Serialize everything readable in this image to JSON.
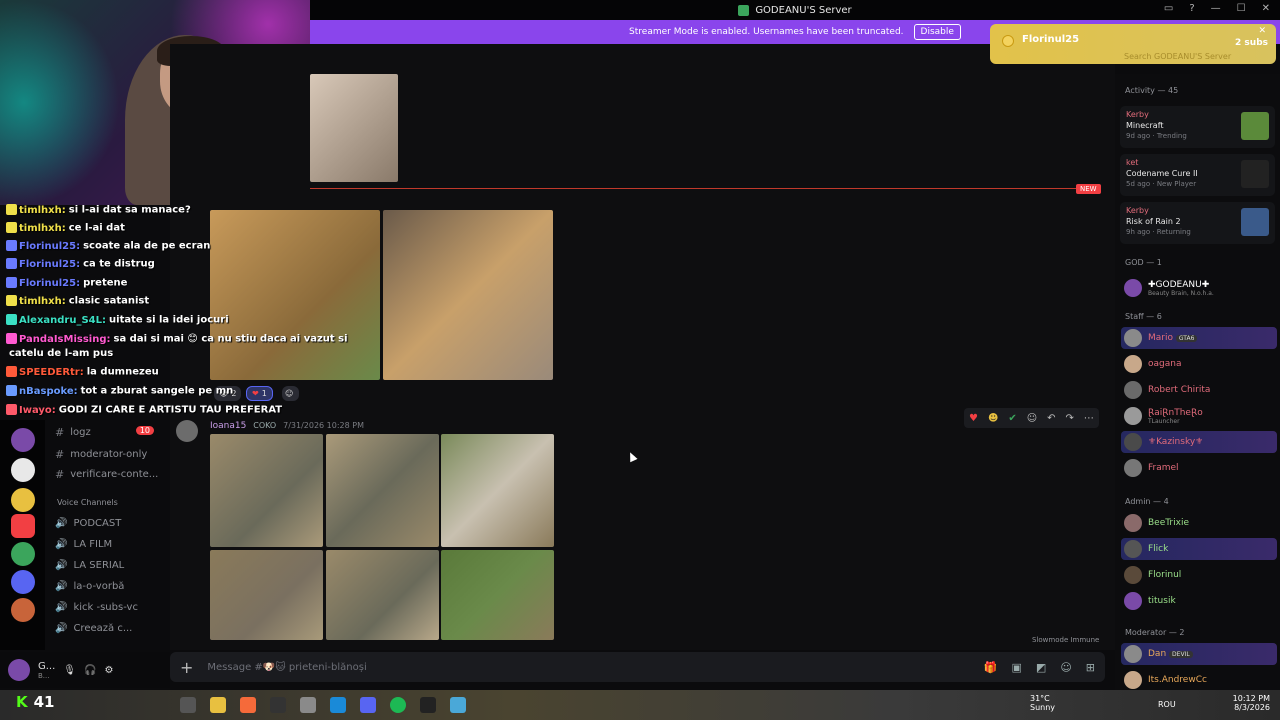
{
  "window": {
    "title": "GODEANU'S Server"
  },
  "banner": {
    "text": "Streamer Mode is enabled. Usernames have been truncated.",
    "disable_label": "Disable"
  },
  "alert": {
    "name": "Florinul25",
    "subs": "2 subs",
    "search_placeholder": "Search GODEANU'S Server"
  },
  "new_tag": "NEW",
  "channels": [
    {
      "label": "logz",
      "badge": "10"
    },
    {
      "label": "moderator-only"
    },
    {
      "label": "verificare-conte..."
    }
  ],
  "voice_header": "Voice Channels",
  "voice_channels": [
    "PODCAST",
    "LA FILM",
    "LA SERIAL",
    "la-o-vorbă",
    "kick -subs-vc",
    "Creează c..."
  ],
  "message": {
    "author": "Ioana15",
    "tag": "COKO",
    "time": "7/31/2026 10:28 PM",
    "reactions": [
      {
        "emoji": "😭",
        "count": "2"
      },
      {
        "emoji": "❤",
        "count": "1"
      }
    ]
  },
  "msgbar": {
    "placeholder": "Message #🐶🐱 prieteni-blănoși"
  },
  "slowmode": "Slowmode Immune",
  "userpanel": {
    "name": "G...",
    "sub": "B..."
  },
  "members": {
    "activity_header": "Activity — 45",
    "activities": [
      {
        "who": "Kerby",
        "game": "Minecraft",
        "meta": "9d ago · Trending",
        "color": "#5b8a3a"
      },
      {
        "who": "ket",
        "game": "Codename Cure II",
        "meta": "5d ago · New Player",
        "color": "#222"
      },
      {
        "who": "Kerby",
        "game": "Risk of Rain 2",
        "meta": "9h ago · Returning",
        "color": "#3a5a8a"
      }
    ],
    "groups": [
      {
        "header": "GOD — 1",
        "members": [
          {
            "name": "✚GODEANU✚",
            "sub": "Beauty Brain, N.o.h.a.",
            "color": "#fff"
          }
        ]
      },
      {
        "header": "Staff — 6",
        "members": [
          {
            "name": "Mario",
            "badge": "GTA6",
            "color": "#e06b7a",
            "hl": true
          },
          {
            "name": "oagana",
            "color": "#e06b7a"
          },
          {
            "name": "Robert Chirita",
            "color": "#e06b7a"
          },
          {
            "name": "ⱤaiⱤnTheⱤo",
            "sub": "TLauncher",
            "color": "#e06b7a"
          },
          {
            "name": "⚜Kazinsky⚜",
            "color": "#e06b7a",
            "hl": true
          },
          {
            "name": "Framel",
            "color": "#e06b7a"
          }
        ]
      },
      {
        "header": "Admin — 4",
        "members": [
          {
            "name": "BeeTrixie",
            "color": "#9be08a"
          },
          {
            "name": "Flick",
            "color": "#9be08a",
            "hl": true
          },
          {
            "name": "Florinul",
            "color": "#9be08a"
          },
          {
            "name": "titusik",
            "color": "#9be08a"
          }
        ]
      },
      {
        "header": "Moderator — 2",
        "members": [
          {
            "name": "Dan",
            "badge": "DEVIL",
            "color": "#e8a85a",
            "hl": true
          },
          {
            "name": "Its.AndrewCc",
            "color": "#e8a85a"
          }
        ]
      }
    ]
  },
  "twitch_chat": [
    {
      "name": "timlhxh:",
      "msg": "si l-ai dat sa manace?",
      "color": "#f0e04a"
    },
    {
      "name": "timlhxh:",
      "msg": "ce l-ai dat",
      "color": "#f0e04a"
    },
    {
      "name": "Florinul25:",
      "msg": "scoate ala de pe ecran",
      "color": "#6a7bff"
    },
    {
      "name": "Florinul25:",
      "msg": "ca te distrug",
      "color": "#6a7bff"
    },
    {
      "name": "Florinul25:",
      "msg": "pretene",
      "color": "#6a7bff"
    },
    {
      "name": "timlhxh:",
      "msg": "clasic satanist",
      "color": "#f0e04a"
    },
    {
      "name": "Alexandru_S4L:",
      "msg": "uitate si la idei jocuri",
      "color": "#3be0c4"
    },
    {
      "name": "PandaIsMissing:",
      "msg": "sa dai si mai 😊 ca nu stiu daca ai vazut si",
      "color": "#ff5ad0"
    },
    {
      "name": "",
      "msg": "catelu de l-am pus",
      "color": "#fff"
    },
    {
      "name": "SPEEDERtr:",
      "msg": "la dumnezeu",
      "color": "#ff5a3a"
    },
    {
      "name": "nBaspoke:",
      "msg": "tot a zburat sangele pe mn",
      "color": "#6a9bff"
    },
    {
      "name": "Iwayo:",
      "msg": "GODI ZI CARE E ARTISTU TAU PREFERAT",
      "color": "#ff5a6a"
    }
  ],
  "taskbar": {
    "viewer_count": "41",
    "weather": "31°C",
    "weather_sub": "Sunny",
    "lang": "ROU",
    "time": "10:12 PM",
    "date": "8/3/2026"
  }
}
